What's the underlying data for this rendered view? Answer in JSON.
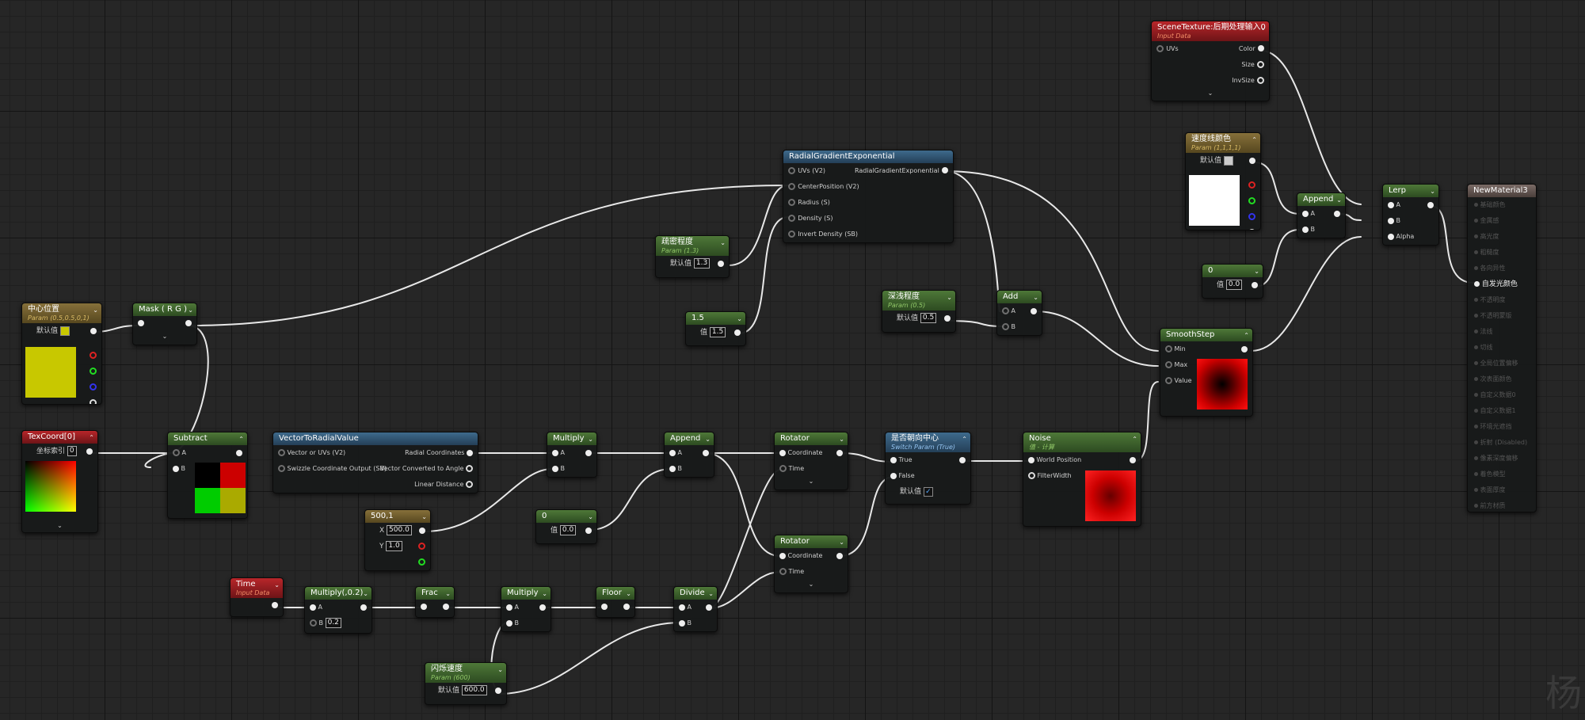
{
  "nodes": {
    "scenetex": {
      "title": "SceneTexture:后期处理输入0",
      "sub": "Input Data",
      "in_uvs": "UVs",
      "out_color": "Color",
      "out_size": "Size",
      "out_invsize": "InvSize"
    },
    "speedcolor": {
      "title": "速度线颜色",
      "sub": "Param (1,1,1,1)",
      "label": "默认值",
      "color": "#ffffff"
    },
    "radial": {
      "title": "RadialGradientExponential",
      "in_uvs": "UVs (V2)",
      "in_center": "CenterPosition (V2)",
      "in_radius": "Radius (S)",
      "in_density": "Density (S)",
      "in_invert": "Invert Density (SB)",
      "out": "RadialGradientExponential"
    },
    "density": {
      "title": "疏密程度",
      "sub": "Param (1.3)",
      "label": "默认值",
      "value": "1.3"
    },
    "c15": {
      "title": "1.5",
      "label": "值",
      "value": "1.5"
    },
    "depth": {
      "title": "深浅程度",
      "sub": "Param (0.5)",
      "label": "默认值",
      "value": "0.5"
    },
    "add": {
      "title": "Add",
      "a": "A",
      "b": "B"
    },
    "append_top": {
      "title": "Append",
      "a": "A",
      "b": "B"
    },
    "zero_top": {
      "title": "0",
      "label": "值",
      "value": "0.0"
    },
    "lerp": {
      "title": "Lerp",
      "a": "A",
      "b": "B",
      "alpha": "Alpha"
    },
    "smoothstep": {
      "title": "SmoothStep",
      "min": "Min",
      "max": "Max",
      "value": "Value"
    },
    "material": {
      "title": "NewMaterial3",
      "rows": [
        "基础颜色",
        "金属感",
        "高光度",
        "粗糙度",
        "各向异性",
        "自发光颜色",
        "不透明度",
        "不透明蒙版",
        "法线",
        "切线",
        "全局位置偏移",
        "次表面颜色",
        "自定义数据0",
        "自定义数据1",
        "环境光遮挡",
        "折射 (Disabled)",
        "像素深度偏移",
        "着色模型",
        "表面厚度",
        "前方材质"
      ],
      "active_index": 5
    },
    "center": {
      "title": "中心位置",
      "sub": "Param (0.5,0.5,0,1)",
      "label": "默认值",
      "color": "#c8c800"
    },
    "mask": {
      "title": "Mask ( R G )"
    },
    "texcoord": {
      "title": "TexCoord[0]",
      "label": "坐标索引",
      "value": "0"
    },
    "subtract": {
      "title": "Subtract",
      "a": "A",
      "b": "B"
    },
    "v2r": {
      "title": "VectorToRadialValue",
      "in_vec": "Vector or UVs (V2)",
      "in_swz": "Swizzle Coordinate Output (SB)",
      "out_rad": "Radial Coordinates",
      "out_angle": "Vector Converted to Angle",
      "out_dist": "Linear Distance"
    },
    "multiply1": {
      "title": "Multiply",
      "a": "A",
      "b": "B"
    },
    "append2": {
      "title": "Append",
      "a": "A",
      "b": "B"
    },
    "rotator1": {
      "title": "Rotator",
      "coord": "Coordinate",
      "time": "Time"
    },
    "rotator2": {
      "title": "Rotator",
      "coord": "Coordinate",
      "time": "Time"
    },
    "switch": {
      "title": "是否朝向中心",
      "sub": "Switch Param (True)",
      "t": "True",
      "f": "False",
      "label": "默认值",
      "checked": "✓"
    },
    "noise": {
      "title": "Noise",
      "sub": "值 - 计算",
      "wp": "World Position",
      "fw": "FilterWidth"
    },
    "c500": {
      "title": "500,1",
      "xlabel": "X",
      "xval": "500.0",
      "ylabel": "Y",
      "yval": "1.0"
    },
    "zero2": {
      "title": "0",
      "label": "值",
      "value": "0.0"
    },
    "time": {
      "title": "Time",
      "sub": "Input Data"
    },
    "mul02": {
      "title": "Multiply(,0.2)",
      "a": "A",
      "b": "B",
      "bval": "0.2"
    },
    "frac": {
      "title": "Frac"
    },
    "multiply2": {
      "title": "Multiply",
      "a": "A",
      "b": "B"
    },
    "floor": {
      "title": "Floor"
    },
    "divide": {
      "title": "Divide",
      "a": "A",
      "b": "B"
    },
    "flash": {
      "title": "闪烁速度",
      "sub": "Param (600)",
      "label": "默认值",
      "value": "600.0"
    }
  },
  "watermark": "杨"
}
